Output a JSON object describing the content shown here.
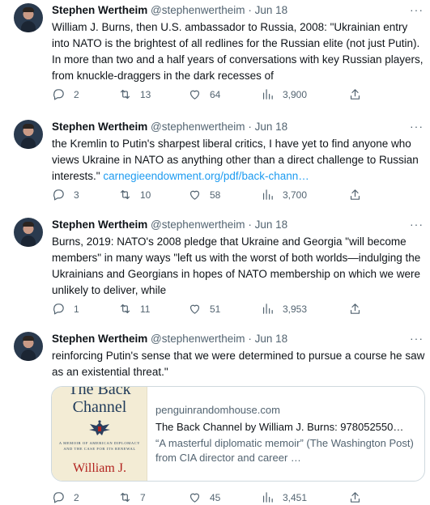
{
  "tweets": [
    {
      "author_name": "Stephen Wertheim",
      "handle": "@stephenwertheim",
      "separator": "·",
      "date": "Jun 18",
      "more": "···",
      "text": "William J. Burns, then U.S. ambassador to Russia, 2008: \"Ukrainian entry into NATO is the brightest of all redlines for the Russian elite (not just Putin). In more than two and a half years of conversations with key Russian players, from knuckle-draggers in the dark recesses of",
      "link": "",
      "replies": "2",
      "retweets": "13",
      "likes": "64",
      "views": "3,900"
    },
    {
      "author_name": "Stephen Wertheim",
      "handle": "@stephenwertheim",
      "separator": "·",
      "date": "Jun 18",
      "more": "···",
      "text": "the Kremlin to Putin's sharpest liberal critics, I have yet to find anyone who views Ukraine in NATO as anything other than a direct challenge to Russian interests.\" ",
      "link": "carnegieendowment.org/pdf/back-chann…",
      "replies": "3",
      "retweets": "10",
      "likes": "58",
      "views": "3,700"
    },
    {
      "author_name": "Stephen Wertheim",
      "handle": "@stephenwertheim",
      "separator": "·",
      "date": "Jun 18",
      "more": "···",
      "text": "Burns, 2019: NATO's 2008 pledge that Ukraine and Georgia \"will become members\" in many ways \"left us with the worst of both worlds—indulging the Ukrainians and Georgians in hopes of NATO membership on which we were unlikely to deliver, while",
      "link": "",
      "replies": "1",
      "retweets": "11",
      "likes": "51",
      "views": "3,953"
    },
    {
      "author_name": "Stephen Wertheim",
      "handle": "@stephenwertheim",
      "separator": "·",
      "date": "Jun 18",
      "more": "···",
      "text": "reinforcing Putin's sense that we were determined to pursue a course he saw as an existential threat.\"",
      "link": "",
      "replies": "2",
      "retweets": "7",
      "likes": "45",
      "views": "3,451"
    }
  ],
  "card": {
    "cover_title_line1": "The Back",
    "cover_title_line2": "Channel",
    "cover_subtitle": "A MEMOIR OF AMERICAN DIPLOMACY AND THE CASE FOR ITS RENEWAL",
    "cover_author": "William J.",
    "domain": "penguinrandomhouse.com",
    "title": "The Back Channel by William J. Burns: 978052550…",
    "description": "“A masterful diplomatic memoir” (The Washington Post) from CIA director and career …"
  },
  "icons": {
    "reply": "reply-bubble-icon",
    "retweet": "retweet-arrows-icon",
    "like": "heart-icon",
    "views": "views-bar-chart-icon",
    "share": "share-upload-icon"
  },
  "colors": {
    "text": "#0f1419",
    "secondary": "#536471",
    "link": "#1d9bf0",
    "border": "#cfd9de"
  }
}
